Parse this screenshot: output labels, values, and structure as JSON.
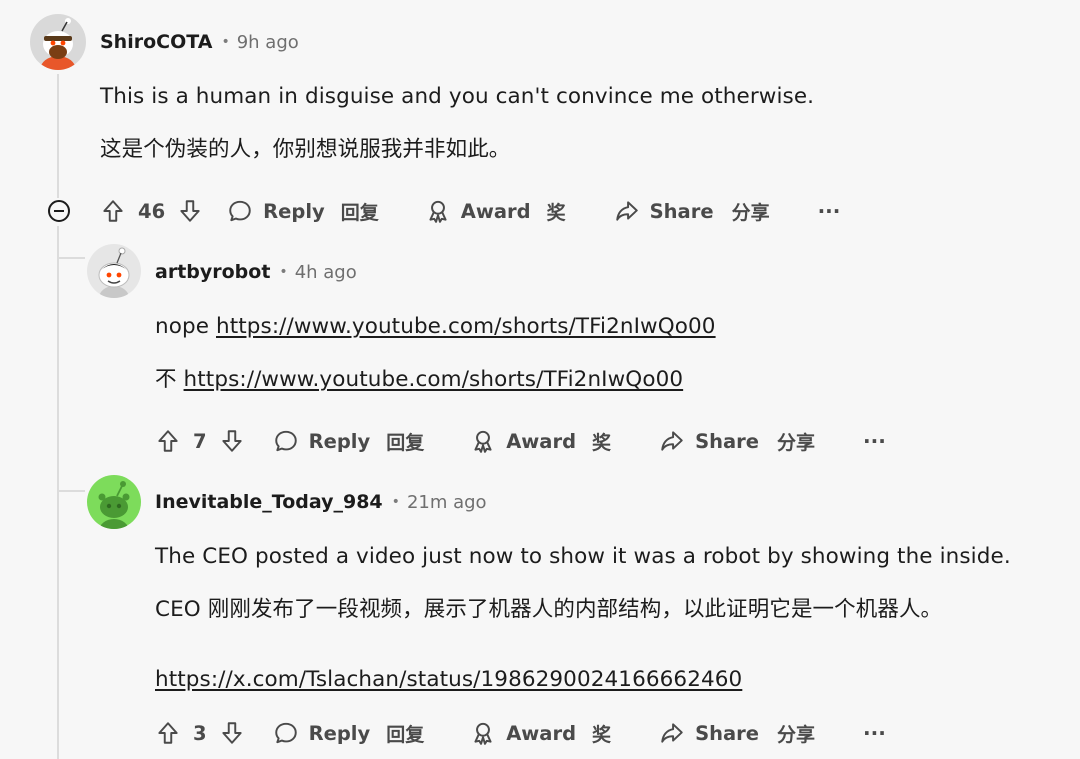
{
  "comments": [
    {
      "username": "ShiroCOTA",
      "time": "9h ago",
      "lines": [
        "This is a human in disguise and you can't convince me otherwise.",
        "这是个伪装的人，你别想说服我并非如此。"
      ],
      "score": "46"
    },
    {
      "username": "artbyrobot",
      "time": "4h ago",
      "line1_prefix": "nope",
      "line2_prefix": "不",
      "link": "https://www.youtube.com/shorts/TFi2nIwQo00",
      "score": "7"
    },
    {
      "username": "Inevitable_Today_984",
      "time": "21m ago",
      "lines": [
        "The CEO posted a video just now to show it was a robot by showing the inside.",
        "CEO 刚刚发布了一段视频，展示了机器人的内部结构，以此证明它是一个机器人。"
      ],
      "link": "https://x.com/Tslachan/status/1986290024166662460",
      "score": "3"
    }
  ],
  "actions": {
    "reply": "Reply",
    "reply_zh": "回复",
    "award": "Award",
    "award_zh": "奖",
    "share": "Share",
    "share_zh": "分享",
    "more": "···"
  },
  "dot": "•",
  "icons": [
    "upvote-icon",
    "downvote-icon",
    "reply-icon",
    "award-icon",
    "share-icon",
    "more-icon",
    "collapse-icon"
  ],
  "colors": {
    "background": "#f7f7f7",
    "text": "#1c1c1c",
    "muted": "#6f6f6f",
    "thread": "#dcdcdc"
  }
}
